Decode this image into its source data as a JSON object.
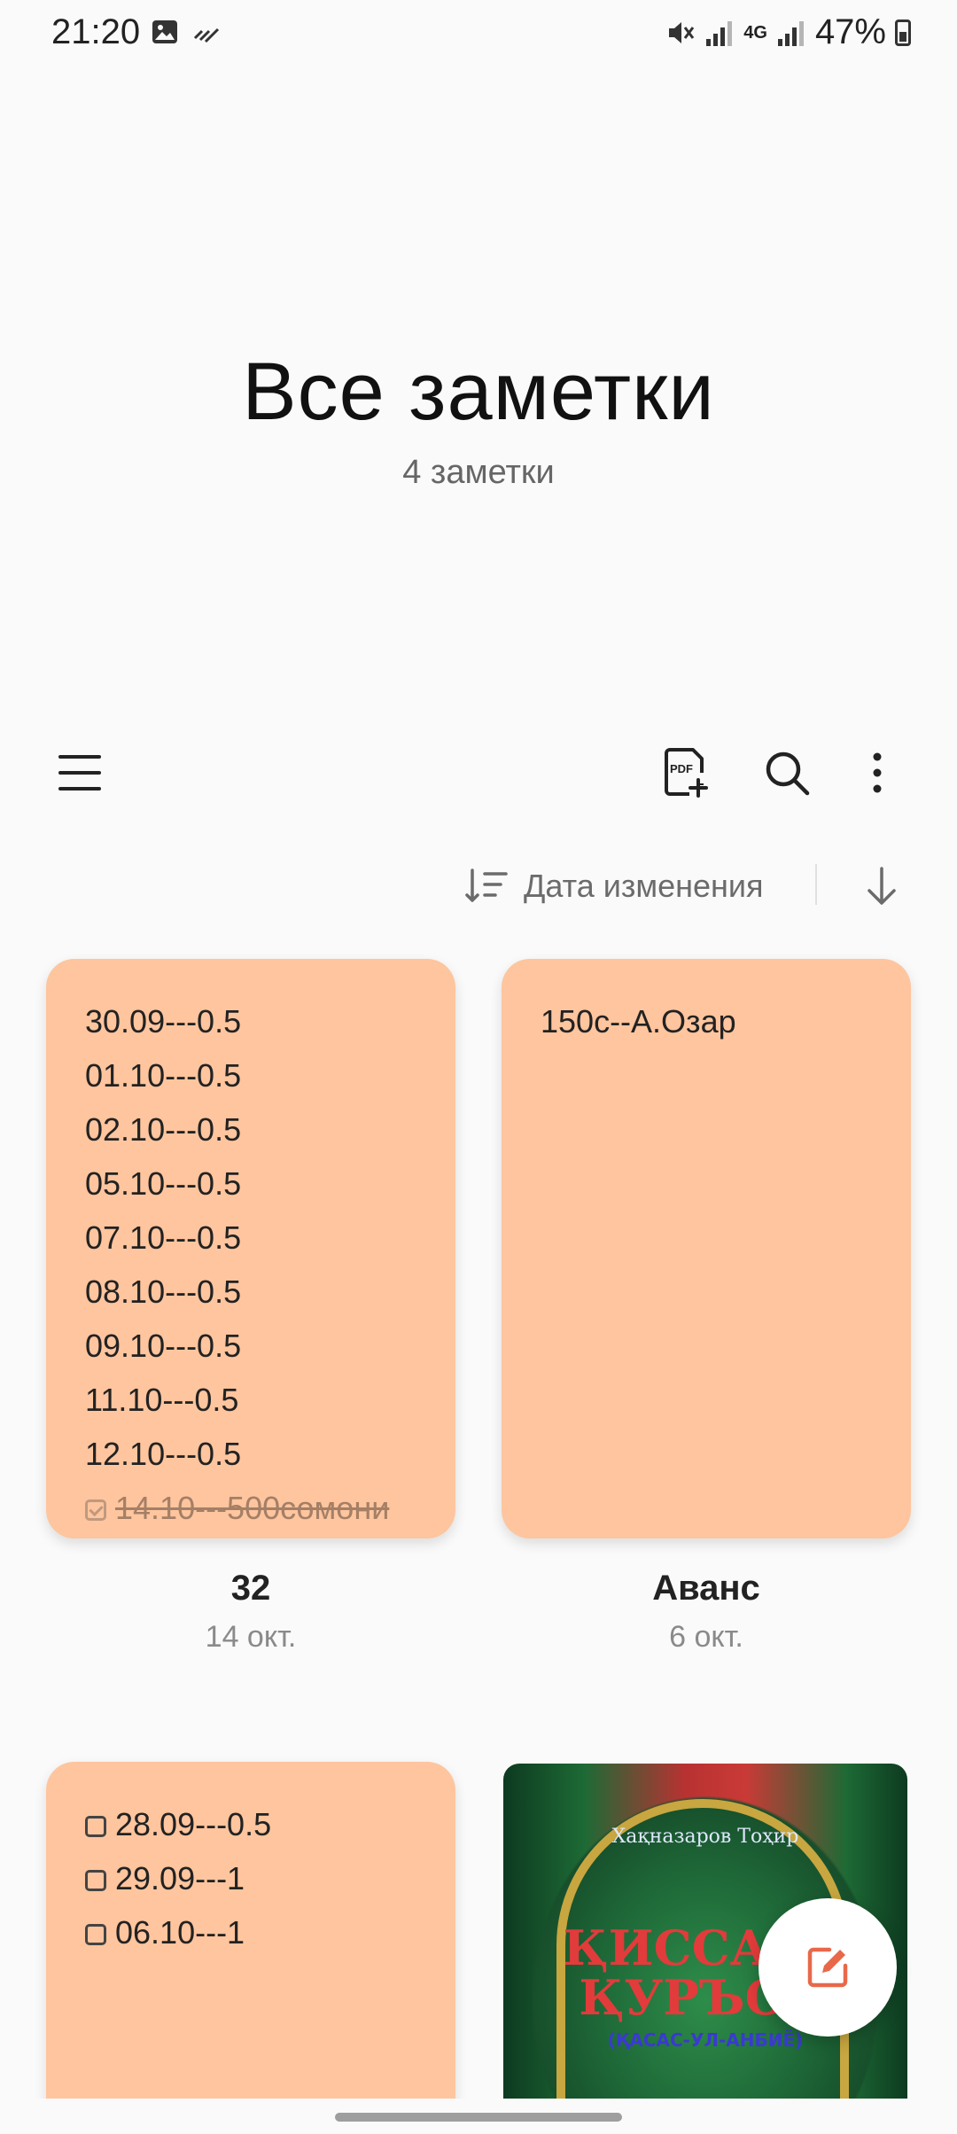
{
  "status_bar": {
    "time": "21:20",
    "network": "4G",
    "battery": "47%",
    "left_icons": [
      "image-icon",
      "missed-call-icon"
    ],
    "right_icons": [
      "mute-icon",
      "signal-icon",
      "data-4g-icon",
      "signal-icon",
      "battery-icon"
    ]
  },
  "header": {
    "title": "Все заметки",
    "count": "4 заметки"
  },
  "toolbar": {
    "menu_icon": "hamburger-menu-icon",
    "pdf_icon": "pdf-add-icon",
    "search_icon": "search-icon",
    "more_icon": "more-vertical-icon"
  },
  "sort": {
    "label": "Дата изменения",
    "sort_icon": "sort-icon",
    "direction_icon": "arrow-down-icon"
  },
  "notes": [
    {
      "title": "32",
      "date": "14 окт.",
      "color": "#fec59e",
      "lines": [
        "30.09---0.5",
        "01.10---0.5",
        "02.10---0.5",
        "05.10---0.5",
        "07.10---0.5",
        "08.10---0.5",
        "09.10---0.5",
        "11.10---0.5",
        "12.10---0.5"
      ],
      "checked_line": "14.10---500сомони"
    },
    {
      "title": "Аванс",
      "date": "6 окт.",
      "color": "#fec59e",
      "lines": [
        "150с--А.Озар"
      ]
    },
    {
      "color": "#fec59e",
      "checklist": [
        "28.09---0.5",
        "29.09---1",
        "06.10---1"
      ]
    },
    {
      "image": "book-cover",
      "cover_author": "Хақназаров Тоҳир",
      "cover_title_line1": "ҚИССАХО",
      "cover_title_line2": "ҚУРЪОН",
      "cover_subtitle": "(ҚАСАС-УЛ-АНБИЁ)"
    }
  ],
  "fab": {
    "icon": "compose-note-icon",
    "accent": "#e8684a"
  }
}
